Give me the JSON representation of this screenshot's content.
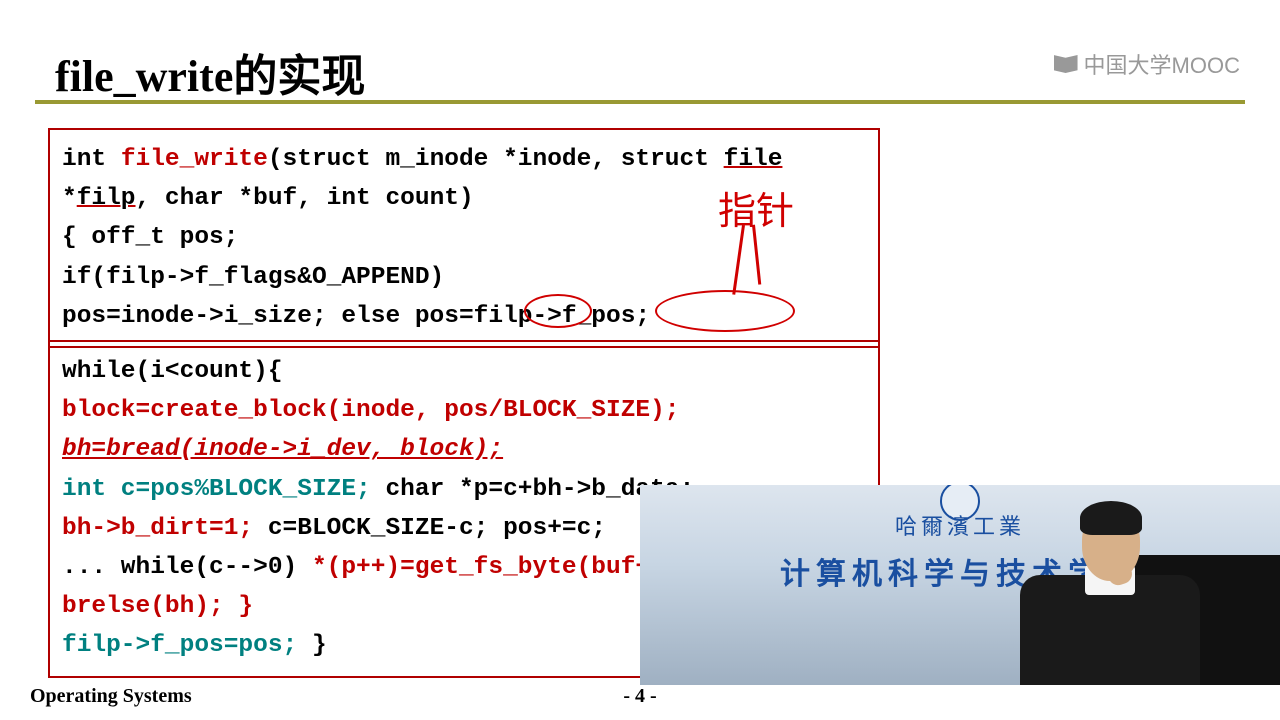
{
  "title": "file_write的实现",
  "logo_text": "中国大学MOOC",
  "code1": {
    "l1a": "int ",
    "l1b": "file_write",
    "l1c": "(struct m_inode *inode, struct ",
    "l1d": "file",
    "l2a": "*",
    "l2b": "filp",
    "l2c": ", char *buf, int count)",
    "l3": "{   off_t pos;",
    "l4": "    if(filp->f_flags&O_APPEND)",
    "l5a": "      pos=inode->i_size; else ",
    "l5b": "pos=filp->f_pos;"
  },
  "code2": {
    "l1": "while(i<count){",
    "l2": "  block=create_block(inode, pos/BLOCK_SIZE);",
    "l3": "  bh=bread(inode->i_dev, block);",
    "l4a": "  int c=pos%BLOCK_SIZE;",
    "l4b": " char *p=c+bh->b_data;",
    "l5a": "  bh->b_dirt=1;",
    "l5b": " c=BLOCK_SIZE-c; pos+=c;",
    "l6a": "  ... while(c-->0) ",
    "l6b": "*(p++)=get_fs_byte(buf++);",
    "l7": "  brelse(bh); }",
    "l8a": "filp->f_pos=pos;",
    "l8b": " }"
  },
  "annotation": {
    "handwritten": "指针"
  },
  "video": {
    "university": "哈爾濱工業",
    "department": "计算机科学与技术学院"
  },
  "footer": {
    "left": "Operating Systems",
    "page": "- 4 -"
  }
}
